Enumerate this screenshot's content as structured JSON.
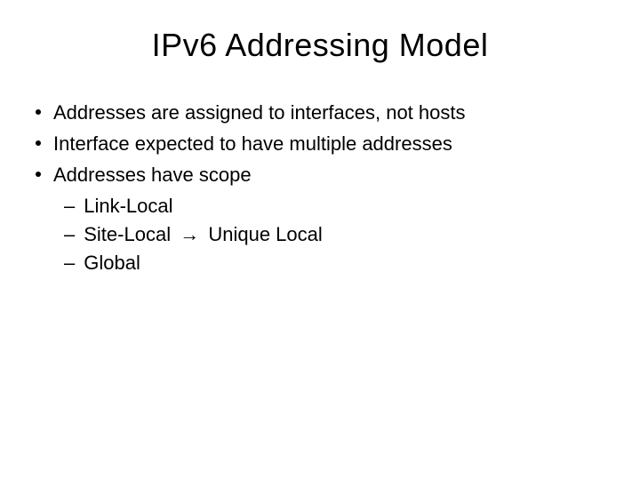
{
  "title": "IPv6 Addressing Model",
  "bullets": [
    {
      "text": "Addresses are assigned to interfaces, not hosts"
    },
    {
      "text": "Interface expected to have multiple addresses"
    },
    {
      "text": "Addresses have scope"
    }
  ],
  "sub_bullets": {
    "item0": "Link-Local",
    "item1_prefix": "Site-Local",
    "item1_suffix": "Unique Local",
    "item2": "Global"
  },
  "arrow_glyph": "→"
}
